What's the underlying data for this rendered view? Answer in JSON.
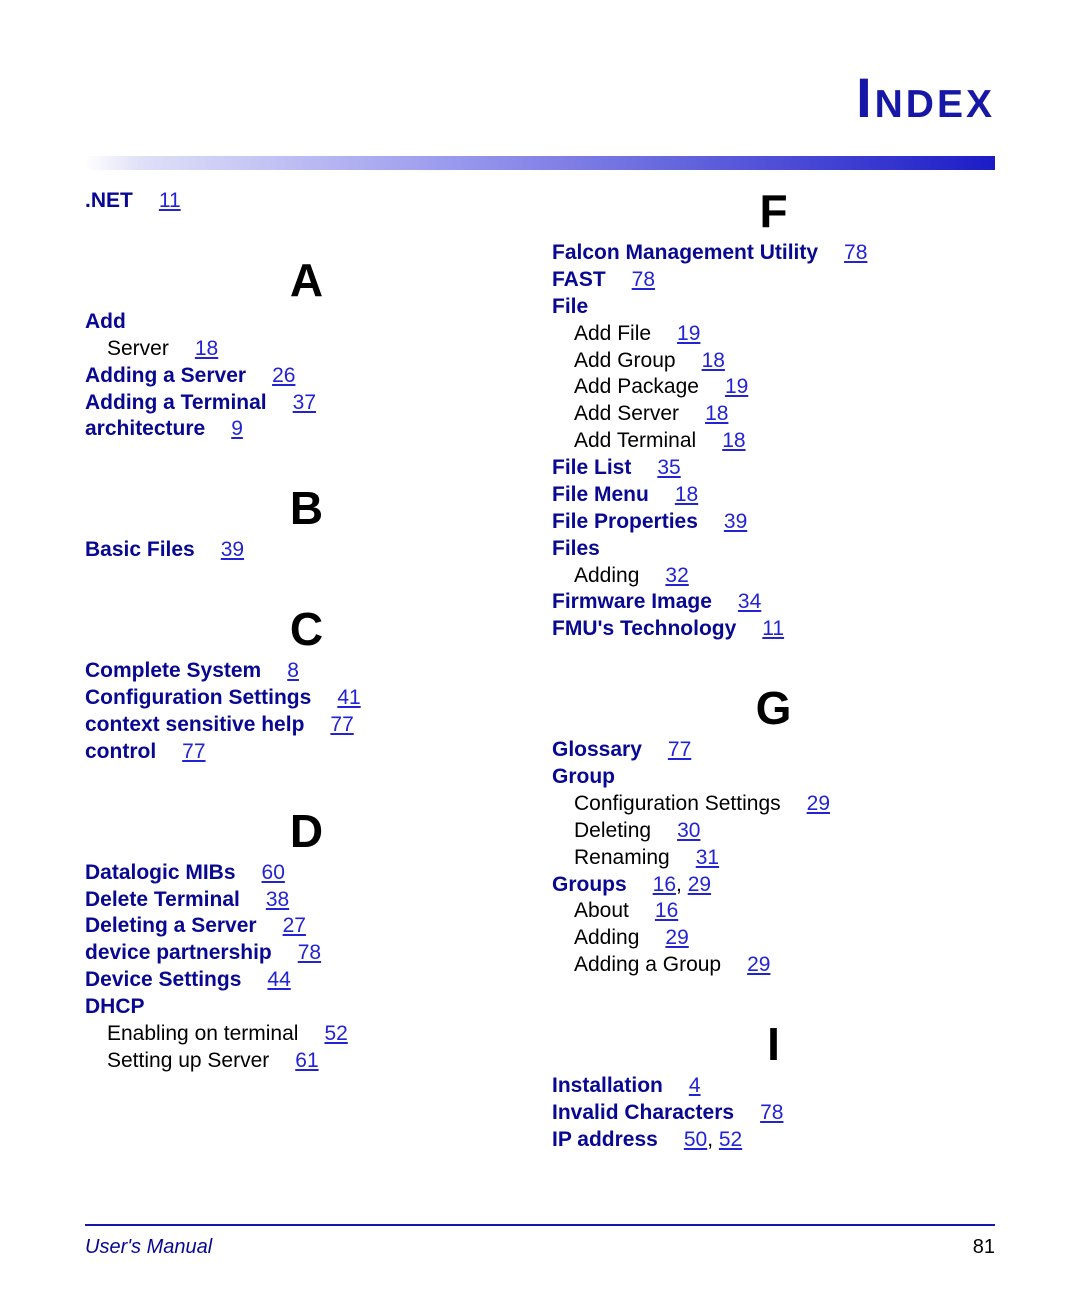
{
  "title": "Index",
  "footer": {
    "left": "User's Manual",
    "page": "81"
  },
  "left": {
    "net": {
      "label": ".NET",
      "page": "11"
    },
    "A": {
      "heading": "A",
      "add": {
        "label": "Add"
      },
      "add_server": {
        "label": "Server",
        "page": "18"
      },
      "adding_server": {
        "label": "Adding a Server",
        "page": "26"
      },
      "adding_terminal": {
        "label": "Adding a Terminal",
        "page": "37"
      },
      "architecture": {
        "label": "architecture",
        "page": "9"
      }
    },
    "B": {
      "heading": "B",
      "basic_files": {
        "label": "Basic Files",
        "page": "39"
      }
    },
    "C": {
      "heading": "C",
      "complete_system": {
        "label": "Complete System",
        "page": "8"
      },
      "config_settings": {
        "label": "Configuration Settings",
        "page": "41"
      },
      "context_help": {
        "label": "context sensitive help",
        "page": "77"
      },
      "control": {
        "label": "control",
        "page": "77"
      }
    },
    "D": {
      "heading": "D",
      "datalogic_mibs": {
        "label": "Datalogic MIBs",
        "page": "60"
      },
      "delete_terminal": {
        "label": "Delete Terminal",
        "page": "38"
      },
      "deleting_server": {
        "label": "Deleting a Server",
        "page": "27"
      },
      "device_partnership": {
        "label": "device partnership",
        "page": "78"
      },
      "device_settings": {
        "label": "Device Settings",
        "page": "44"
      },
      "dhcp": {
        "label": "DHCP"
      },
      "dhcp_enable": {
        "label": "Enabling on terminal",
        "page": "52"
      },
      "dhcp_setup": {
        "label": "Setting up Server",
        "page": "61"
      }
    }
  },
  "right": {
    "F": {
      "heading": "F",
      "fmu": {
        "label": "Falcon Management Utility",
        "page": "78"
      },
      "fast": {
        "label": "FAST",
        "page": "78"
      },
      "file": {
        "label": "File"
      },
      "file_addfile": {
        "label": "Add File",
        "page": "19"
      },
      "file_addgroup": {
        "label": "Add Group",
        "page": "18"
      },
      "file_addpackage": {
        "label": "Add Package",
        "page": "19"
      },
      "file_addserver": {
        "label": "Add Server",
        "page": "18"
      },
      "file_addterminal": {
        "label": "Add Terminal",
        "page": "18"
      },
      "file_list": {
        "label": "File List",
        "page": "35"
      },
      "file_menu": {
        "label": "File Menu",
        "page": "18"
      },
      "file_properties": {
        "label": "File Properties",
        "page": "39"
      },
      "files": {
        "label": "Files"
      },
      "files_adding": {
        "label": "Adding",
        "page": "32"
      },
      "firmware_image": {
        "label": "Firmware Image",
        "page": "34"
      },
      "fmu_tech": {
        "label": "FMU's Technology",
        "page": "11"
      }
    },
    "G": {
      "heading": "G",
      "glossary": {
        "label": "Glossary",
        "page": "77"
      },
      "group": {
        "label": "Group"
      },
      "group_config": {
        "label": "Configuration Settings",
        "page": "29"
      },
      "group_deleting": {
        "label": "Deleting",
        "page": "30"
      },
      "group_renaming": {
        "label": "Renaming",
        "page": "31"
      },
      "groups": {
        "label": "Groups",
        "page1": "16",
        "page2": "29"
      },
      "groups_about": {
        "label": "About",
        "page": "16"
      },
      "groups_adding": {
        "label": "Adding",
        "page": "29"
      },
      "groups_addgrp": {
        "label": "Adding a Group",
        "page": "29"
      }
    },
    "I": {
      "heading": "I",
      "installation": {
        "label": "Installation",
        "page": "4"
      },
      "invalid_chars": {
        "label": "Invalid Characters",
        "page": "78"
      },
      "ip_address": {
        "label": "IP address",
        "page1": "50",
        "page2": "52"
      }
    }
  }
}
